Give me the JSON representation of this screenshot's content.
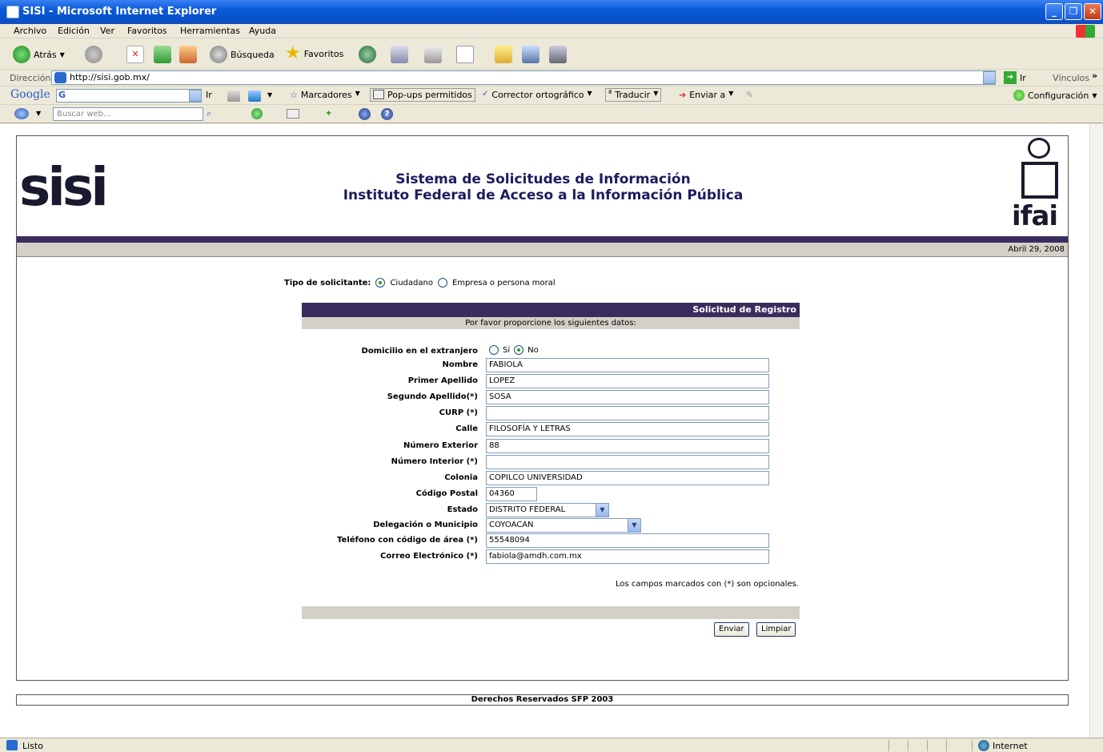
{
  "window": {
    "title": "SISI - Microsoft Internet Explorer"
  },
  "menu": [
    "Archivo",
    "Edición",
    "Ver",
    "Favoritos",
    "Herramientas",
    "Ayuda"
  ],
  "toolbar": {
    "back": "Atrás",
    "search": "Búsqueda",
    "favorites": "Favoritos"
  },
  "address": {
    "label": "Dirección",
    "url": "http://sisi.gob.mx/",
    "go": "Ir",
    "links": "Vínculos"
  },
  "googlebar": {
    "logo": "Google",
    "go": "Ir",
    "bookmarks": "Marcadores",
    "popups": "Pop-ups permitidos",
    "spell": "Corrector ortográfico",
    "translate": "Traducir",
    "send": "Enviar a",
    "settings": "Configuración"
  },
  "searchbar": {
    "placeholder": "Buscar web..."
  },
  "page": {
    "logo_left": "sisi",
    "logo_right": "ifai",
    "header1": "Sistema de Solicitudes de Información",
    "header2": "Instituto Federal de Acceso a la Información Pública",
    "date": "Abril 29, 2008",
    "type_label": "Tipo de solicitante:",
    "type_opt1": "Ciudadano",
    "type_opt2": "Empresa o persona moral",
    "reg_title": "Solicitud de Registro",
    "reg_sub": "Por favor proporcione los siguientes datos:",
    "domicilio_label": "Domicilio en el extranjero",
    "domicilio_si": "Sí",
    "domicilio_no": "No",
    "fields": [
      {
        "label": "Nombre",
        "value": "FABIOLA"
      },
      {
        "label": "Primer Apellido",
        "value": "LOPEZ"
      },
      {
        "label": "Segundo Apellido(*)",
        "value": "SOSA"
      },
      {
        "label": "CURP (*)",
        "value": ""
      },
      {
        "label": "Calle",
        "value": "FILOSOFÍA Y LETRAS"
      },
      {
        "label": "Número Exterior",
        "value": "88"
      },
      {
        "label": "Número Interior (*)",
        "value": ""
      },
      {
        "label": "Colonia",
        "value": "COPILCO UNIVERSIDAD"
      },
      {
        "label": "Código Postal",
        "value": "04360"
      },
      {
        "label": "Estado",
        "value": "DISTRITO FEDERAL"
      },
      {
        "label": "Delegación o Municipio",
        "value": "COYOACAN"
      },
      {
        "label": "Teléfono con código de área (*)",
        "value": "55548094"
      },
      {
        "label": "Correo Electrónico (*)",
        "value": "fabiola@amdh.com.mx"
      }
    ],
    "optional_note": "Los campos marcados con (*) son opcionales.",
    "submit": "Enviar",
    "clear": "Limpiar",
    "footer": "Derechos Reservados SFP 2003"
  },
  "status": {
    "text": "Listo",
    "zone": "Internet"
  }
}
